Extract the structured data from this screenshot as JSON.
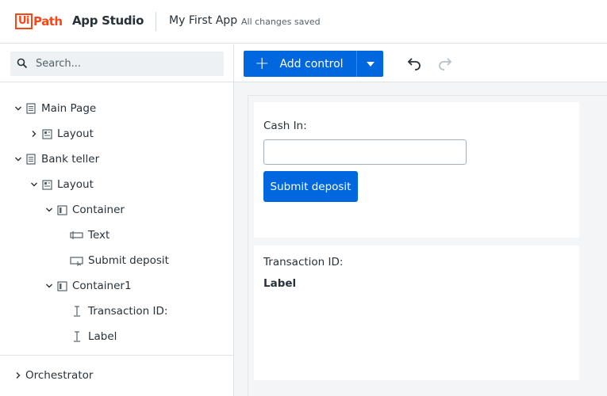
{
  "header": {
    "logo_ui": "Ui",
    "logo_path": "Path",
    "product": "App Studio",
    "app_name": "My First App",
    "save_status": "All changes saved",
    "brand_color": "#fa4616"
  },
  "search": {
    "placeholder": "Search..."
  },
  "tree": [
    {
      "label": "Main Page",
      "icon": "page-icon",
      "expanded": true
    },
    {
      "label": "Layout",
      "icon": "layout-icon",
      "expanded": false
    },
    {
      "label": "Bank teller",
      "icon": "page-icon",
      "expanded": true
    },
    {
      "label": "Layout",
      "icon": "layout-icon",
      "expanded": true
    },
    {
      "label": "Container",
      "icon": "container-icon",
      "expanded": true
    },
    {
      "label": "Text",
      "icon": "textbox-icon"
    },
    {
      "label": "Submit deposit",
      "icon": "button-icon"
    },
    {
      "label": "Container1",
      "icon": "container-icon",
      "expanded": true
    },
    {
      "label": "Transaction ID:",
      "icon": "text-cursor-icon"
    },
    {
      "label": "Label",
      "icon": "text-cursor-icon"
    }
  ],
  "orchestrator": {
    "label": "Orchestrator",
    "expanded": false
  },
  "toolbar": {
    "add_control_label": "Add control",
    "accent_color": "#0067df"
  },
  "canvas": {
    "cash_in_label": "Cash In:",
    "cash_in_value": "",
    "submit_label": "Submit deposit",
    "transaction_label": "Transaction ID:",
    "value_label": "Label"
  }
}
